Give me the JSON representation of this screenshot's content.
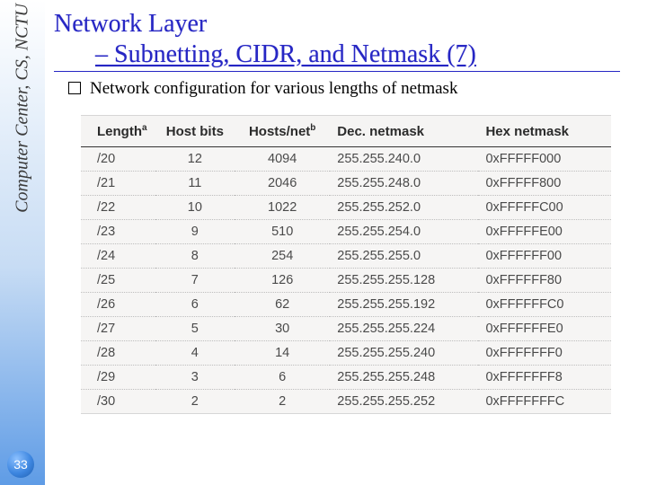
{
  "sidebar": {
    "label": "Computer Center, CS, NCTU"
  },
  "page_number": "33",
  "title": {
    "line1": "Network Layer",
    "line2": "– Subnetting, CIDR, and Netmask (7)"
  },
  "bullet": "Network configuration for various lengths of netmask",
  "table": {
    "headers": {
      "length": "Length",
      "length_sup": "a",
      "hostbits": "Host bits",
      "hostsnet": "Hosts/net",
      "hostsnet_sup": "b",
      "dec": "Dec. netmask",
      "hex": "Hex netmask"
    },
    "rows": [
      {
        "length": "/20",
        "hostbits": "12",
        "hostsnet": "4094",
        "dec": "255.255.240.0",
        "hex": "0xFFFFF000"
      },
      {
        "length": "/21",
        "hostbits": "11",
        "hostsnet": "2046",
        "dec": "255.255.248.0",
        "hex": "0xFFFFF800"
      },
      {
        "length": "/22",
        "hostbits": "10",
        "hostsnet": "1022",
        "dec": "255.255.252.0",
        "hex": "0xFFFFFC00"
      },
      {
        "length": "/23",
        "hostbits": "9",
        "hostsnet": "510",
        "dec": "255.255.254.0",
        "hex": "0xFFFFFE00"
      },
      {
        "length": "/24",
        "hostbits": "8",
        "hostsnet": "254",
        "dec": "255.255.255.0",
        "hex": "0xFFFFFF00"
      },
      {
        "length": "/25",
        "hostbits": "7",
        "hostsnet": "126",
        "dec": "255.255.255.128",
        "hex": "0xFFFFFF80"
      },
      {
        "length": "/26",
        "hostbits": "6",
        "hostsnet": "62",
        "dec": "255.255.255.192",
        "hex": "0xFFFFFFC0"
      },
      {
        "length": "/27",
        "hostbits": "5",
        "hostsnet": "30",
        "dec": "255.255.255.224",
        "hex": "0xFFFFFFE0"
      },
      {
        "length": "/28",
        "hostbits": "4",
        "hostsnet": "14",
        "dec": "255.255.255.240",
        "hex": "0xFFFFFFF0"
      },
      {
        "length": "/29",
        "hostbits": "3",
        "hostsnet": "6",
        "dec": "255.255.255.248",
        "hex": "0xFFFFFFF8"
      },
      {
        "length": "/30",
        "hostbits": "2",
        "hostsnet": "2",
        "dec": "255.255.255.252",
        "hex": "0xFFFFFFFC"
      }
    ]
  }
}
